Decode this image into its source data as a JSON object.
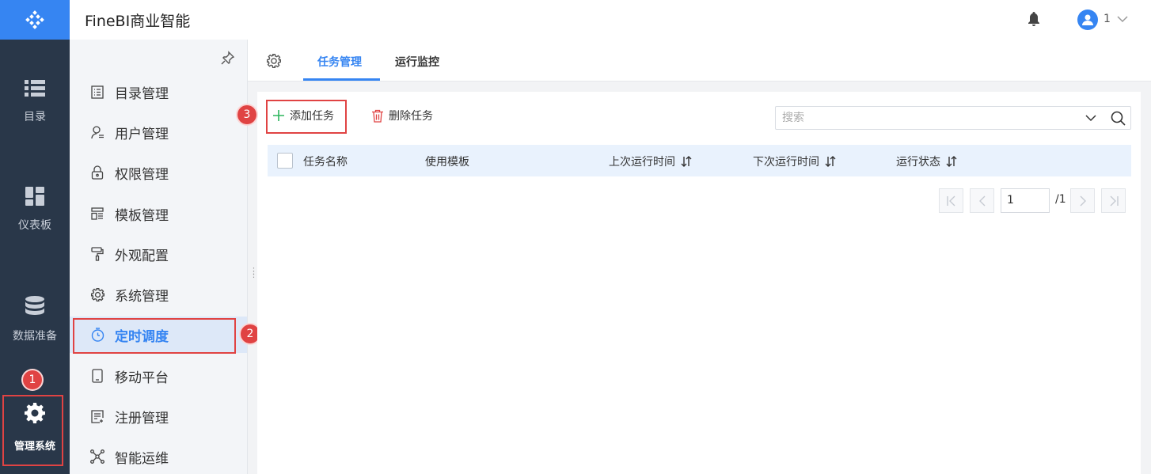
{
  "header": {
    "app_title": "FineBI商业智能",
    "user_name": "1"
  },
  "rail": {
    "items": [
      {
        "label": "目录",
        "icon": "list-icon"
      },
      {
        "label": "仪表板",
        "icon": "dashboard-icon"
      },
      {
        "label": "数据准备",
        "icon": "database-icon"
      },
      {
        "label": "管理系统",
        "icon": "gear-icon"
      }
    ]
  },
  "menu": {
    "items": [
      {
        "label": "目录管理",
        "icon": "catalog-icon"
      },
      {
        "label": "用户管理",
        "icon": "user-icon"
      },
      {
        "label": "权限管理",
        "icon": "lock-icon"
      },
      {
        "label": "模板管理",
        "icon": "template-icon"
      },
      {
        "label": "外观配置",
        "icon": "paint-roller-icon"
      },
      {
        "label": "系统管理",
        "icon": "gear-icon"
      },
      {
        "label": "定时调度",
        "icon": "timer-icon"
      },
      {
        "label": "移动平台",
        "icon": "mobile-icon"
      },
      {
        "label": "注册管理",
        "icon": "register-icon"
      },
      {
        "label": "智能运维",
        "icon": "network-icon"
      }
    ],
    "active_index": 6
  },
  "tabs": [
    {
      "label": "任务管理",
      "active": true
    },
    {
      "label": "运行监控",
      "active": false
    }
  ],
  "toolbar": {
    "add_label": "添加任务",
    "delete_label": "删除任务"
  },
  "search": {
    "placeholder": "搜索"
  },
  "table": {
    "columns": [
      {
        "label": "任务名称",
        "sortable": false
      },
      {
        "label": "使用模板",
        "sortable": false
      },
      {
        "label": "上次运行时间",
        "sortable": true
      },
      {
        "label": "下次运行时间",
        "sortable": true
      },
      {
        "label": "运行状态",
        "sortable": true
      }
    ],
    "rows": []
  },
  "pagination": {
    "current_page": "1",
    "total": "/1"
  },
  "annotations": [
    "1",
    "2",
    "3"
  ],
  "colors": {
    "accent": "#3685f2",
    "rail_bg": "#293749",
    "highlight": "#e04343"
  }
}
